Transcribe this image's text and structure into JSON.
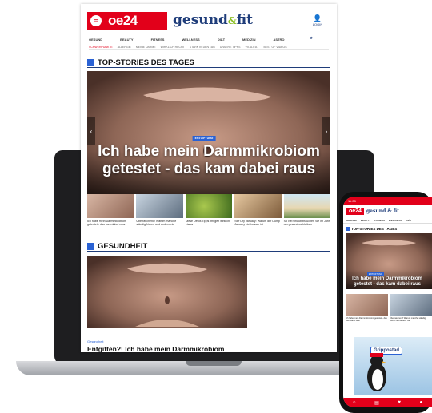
{
  "header": {
    "logo_symbol": "≡",
    "logo_text": "oe24",
    "brand_main": "gesund",
    "brand_amp": "&",
    "brand_tail": "fit",
    "login_label": "LOGIN"
  },
  "nav": {
    "items": [
      "GESUND",
      "BEAUTY",
      "FITNESS",
      "WELLNESS",
      "DIÄT",
      "MEDIZIN",
      "ASTRO"
    ]
  },
  "subnav": {
    "items": [
      "SCHWERPUNKTE",
      "ALLERGIE",
      "MEINE DARME",
      "WIRKLICH RECHT",
      "STARK IN DEN TAG",
      "UNSERE TIPPS",
      "VITALITÄT",
      "BEST OF VIDEOS"
    ]
  },
  "sections": {
    "top_stories": "TOP-STORIES DES TAGES",
    "gesundheit": "GESUNDHEIT"
  },
  "hero": {
    "badge": "ENTGIFTUNG",
    "title": "Ich habe mein Darmmikrobiom getestet - das kam dabei raus"
  },
  "thumbnails": [
    {
      "caption": "Ich habe mein Darmmikrobiom getestet - das kam dabei raus"
    },
    {
      "caption": "Überraschend! Warum manche ständig frieren und andere nie"
    },
    {
      "caption": "Diese Detox-Tipps bringen wirklich etwas"
    },
    {
      "caption": "Stiff Dry January: Warum der Dump January viel besser ist"
    },
    {
      "caption": "So viel Urlaub brauchen Sie im Jahr, um gesund zu bleiben"
    }
  ],
  "article": {
    "category": "Gesundheit",
    "title": "Entgiften?! Ich habe mein Darmmikrobiom"
  },
  "phone": {
    "status_time": "11:08",
    "logo_text": "oe24",
    "brand": "gesund & fit",
    "nav": [
      "GESUND",
      "BEAUTY",
      "FITNESS",
      "WELLNESS",
      "DIÄT"
    ],
    "section": "TOP-STORIES DES TAGES",
    "badge": "ENTGIFTUNG",
    "title": "Ich habe mein Darmmikrobiom getestet - das kam dabei raus",
    "thumb_captions": [
      "Ich habe mein Darmmikrobiom getestet - das kam dabei raus",
      "Überraschend! Warum manche ständig frieren und andere nie"
    ],
    "ad_text": "Grippostad"
  },
  "colors": {
    "brand_red": "#e2001a",
    "brand_blue": "#1f3d7a",
    "accent_blue": "#2a62d4",
    "accent_green": "#8cbf26"
  }
}
